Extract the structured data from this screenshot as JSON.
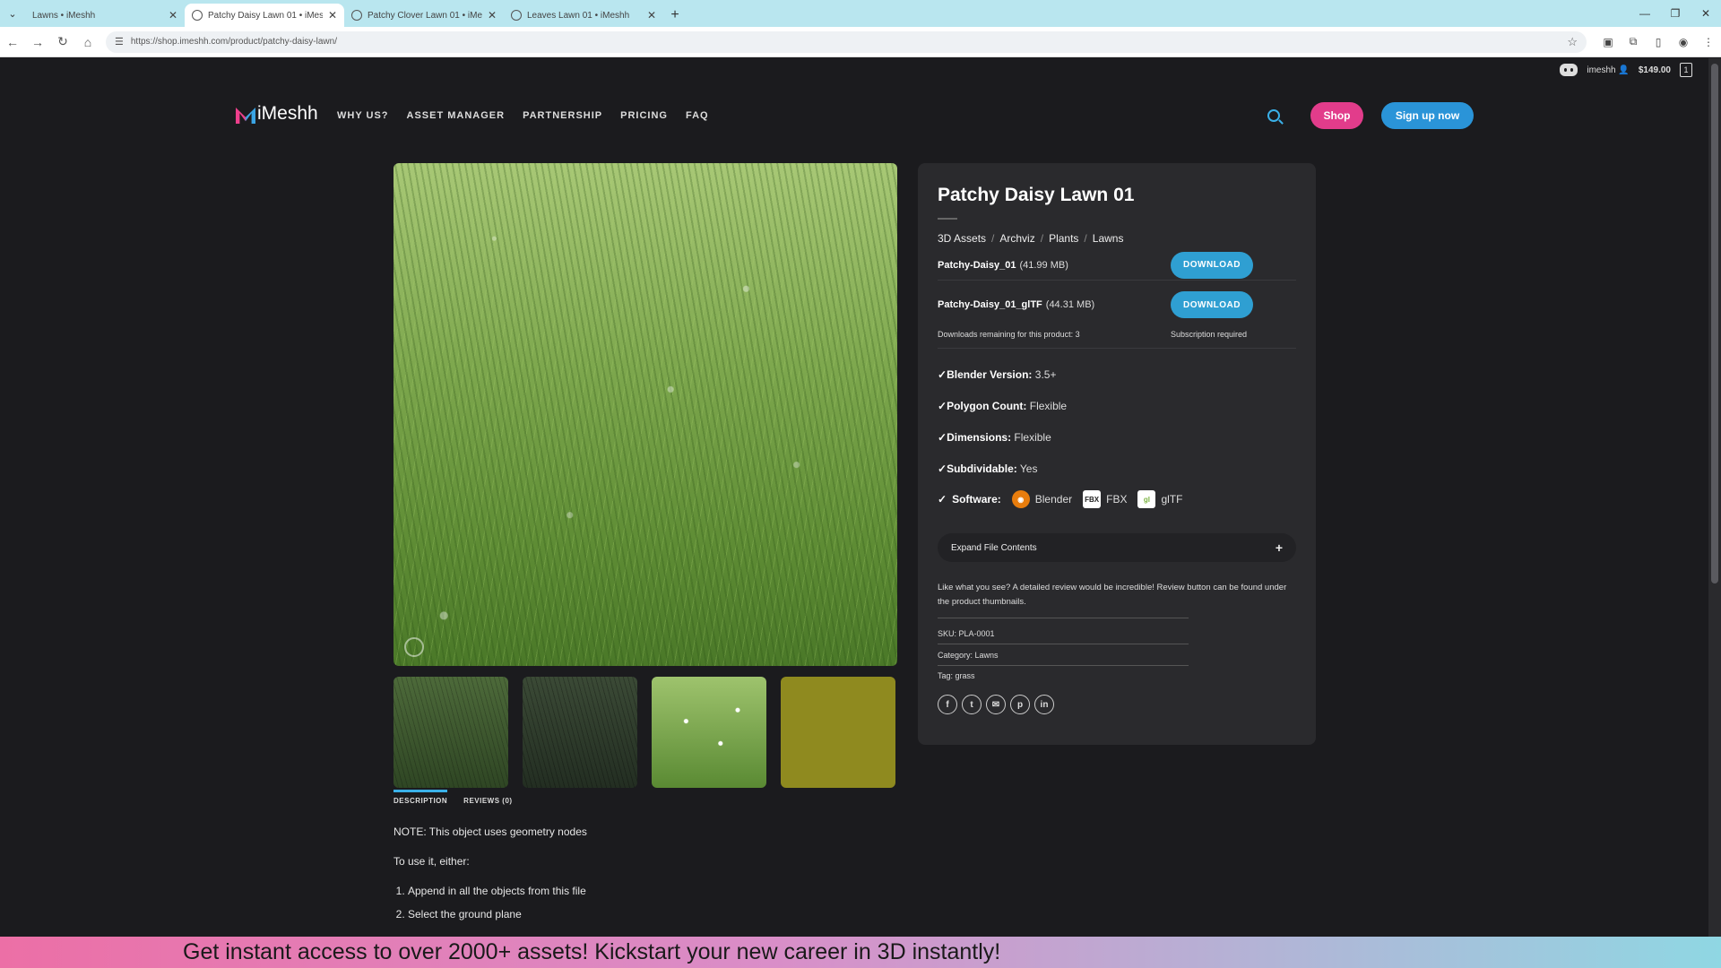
{
  "browser": {
    "tabs": [
      {
        "title": "Lawns • iMeshh",
        "active": false
      },
      {
        "title": "Patchy Daisy Lawn 01 • iMeshh",
        "active": true
      },
      {
        "title": "Patchy Clover Lawn 01 • iMeshh",
        "active": false
      },
      {
        "title": "Leaves Lawn 01 • iMeshh",
        "active": false
      }
    ],
    "url": "https://shop.imeshh.com/product/patchy-daisy-lawn/"
  },
  "topbar": {
    "username": "imeshh",
    "cart_total": "$149.00",
    "cart_count": "1"
  },
  "header": {
    "logo_text": "iMeshh",
    "menu": [
      "WHY US?",
      "ASSET MANAGER",
      "PARTNERSHIP",
      "PRICING",
      "FAQ"
    ],
    "shop_label": "Shop",
    "signup_label": "Sign up now"
  },
  "product": {
    "title": "Patchy Daisy Lawn 01",
    "breadcrumbs": [
      "3D Assets",
      "Archviz",
      "Plants",
      "Lawns"
    ],
    "files": [
      {
        "name": "Patchy-Daisy_01",
        "size": "(41.99 MB)",
        "button": "DOWNLOAD"
      },
      {
        "name": "Patchy-Daisy_01_glTF",
        "size": "(44.31 MB)",
        "button": "DOWNLOAD"
      }
    ],
    "downloads_remaining": "Downloads remaining for this product: 3",
    "subscription_note": "Subscription required",
    "specs": [
      {
        "label": "Blender Version:",
        "value": "3.5+"
      },
      {
        "label": "Polygon Count:",
        "value": "Flexible"
      },
      {
        "label": "Dimensions:",
        "value": "Flexible"
      },
      {
        "label": "Subdividable:",
        "value": "Yes"
      }
    ],
    "software_label": "Software:",
    "software": [
      {
        "name": "Blender",
        "icon": "blender-icon"
      },
      {
        "name": "FBX",
        "icon": "fbx-icon"
      },
      {
        "name": "glTF",
        "icon": "gltf-icon"
      }
    ],
    "expand_label": "Expand File Contents",
    "review_note": "Like what you see? A detailed review would be incredible! Review button can be found under the product thumbnails.",
    "sku": "SKU: PLA-0001",
    "category": "Category: Lawns",
    "tag": "Tag: grass"
  },
  "tabs": [
    "DESCRIPTION",
    "REVIEWS (0)"
  ],
  "description": {
    "note": "NOTE: This object uses geometry nodes",
    "intro": "To use it, either:",
    "steps": [
      "Append in all the objects from this file",
      "Select the ground plane"
    ]
  },
  "banner": "Get instant access to over 2000+ assets! Kickstart your new career in 3D instantly!"
}
